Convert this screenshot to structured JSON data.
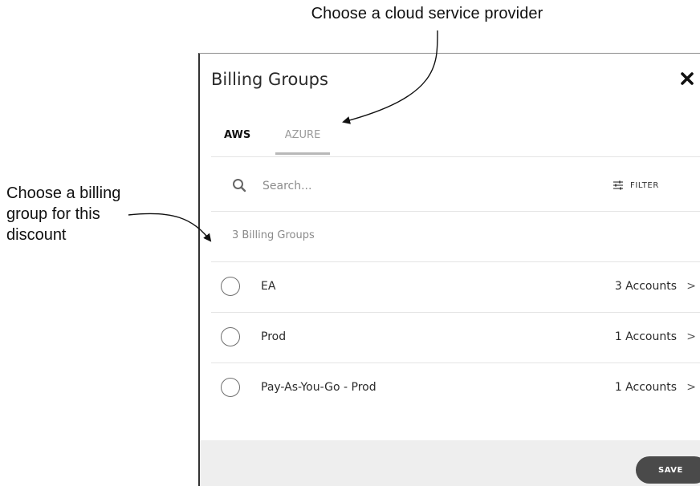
{
  "annotations": {
    "top": "Choose a cloud service provider",
    "left_line1": "Choose a billing",
    "left_line2": "group for this",
    "left_line3": "discount"
  },
  "dialog": {
    "title": "Billing Groups",
    "close_icon": "close-icon"
  },
  "tabs": [
    {
      "label": "AWS",
      "active": true
    },
    {
      "label": "AZURE",
      "active": false
    }
  ],
  "search": {
    "placeholder": "Search...",
    "icon": "search-icon"
  },
  "filter": {
    "label": "FILTER",
    "icon": "sliders-icon"
  },
  "list": {
    "count_label": "3 Billing Groups",
    "items": [
      {
        "name": "EA",
        "accounts": "3 Accounts",
        "chevron": ">"
      },
      {
        "name": "Prod",
        "accounts": "1 Accounts",
        "chevron": ">"
      },
      {
        "name": "Pay-As-You-Go - Prod",
        "accounts": "1 Accounts",
        "chevron": ">"
      }
    ]
  },
  "footer": {
    "save_label": "SAVE"
  },
  "colors": {
    "footer_bg": "#eeeeee",
    "save_bg": "#4a4a4a",
    "tab_underline": "#b8b8b8",
    "muted_text": "#8a8a8a"
  }
}
